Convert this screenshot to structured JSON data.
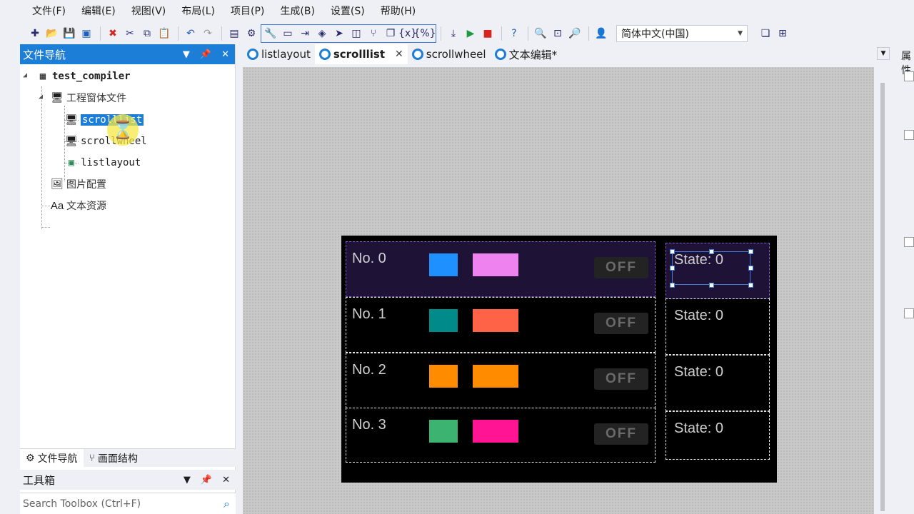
{
  "menu": [
    "文件(F)",
    "编辑(E)",
    "视图(V)",
    "布局(L)",
    "项目(P)",
    "生成(B)",
    "设置(S)",
    "帮助(H)"
  ],
  "toolbar": {
    "language": "简体中文(中国)"
  },
  "left_panel": {
    "title": "文件导航",
    "tree": {
      "root": "test_compiler",
      "project_windows": "工程窗体文件",
      "item_scrolllist": "scrolllist",
      "item_scrollwheel": "scrollwheel",
      "item_listlayout": "listlayout",
      "images": "图片配置",
      "texts": "文本资源"
    },
    "bottom_tabs": [
      "文件导航",
      "画面结构"
    ],
    "toolbox_title": "工具箱",
    "toolbox_search_placeholder": "Search Toolbox (Ctrl+F)"
  },
  "doc_tabs": [
    {
      "label": "listlayout",
      "active": false
    },
    {
      "label": "scrolllist",
      "active": true
    },
    {
      "label": "scrollwheel",
      "active": false
    },
    {
      "label": "文本编辑*",
      "active": false
    }
  ],
  "right_panel": {
    "title": "属性"
  },
  "device": {
    "rows": [
      {
        "label": "No. 0",
        "square_color": "#1e90ff",
        "rect_color": "#ee82ee",
        "button": "OFF",
        "selected": true
      },
      {
        "label": "No. 1",
        "square_color": "#008b8b",
        "rect_color": "#ff6347",
        "button": "OFF",
        "selected": false
      },
      {
        "label": "No. 2",
        "square_color": "#ff8c00",
        "rect_color": "#ff8c00",
        "button": "OFF",
        "selected": false
      },
      {
        "label": "No. 3",
        "square_color": "#3cb371",
        "rect_color": "#ff1493",
        "button": "OFF",
        "selected": false
      }
    ],
    "states": [
      "State: 0",
      "State: 0",
      "State: 0",
      "State: 0"
    ]
  }
}
